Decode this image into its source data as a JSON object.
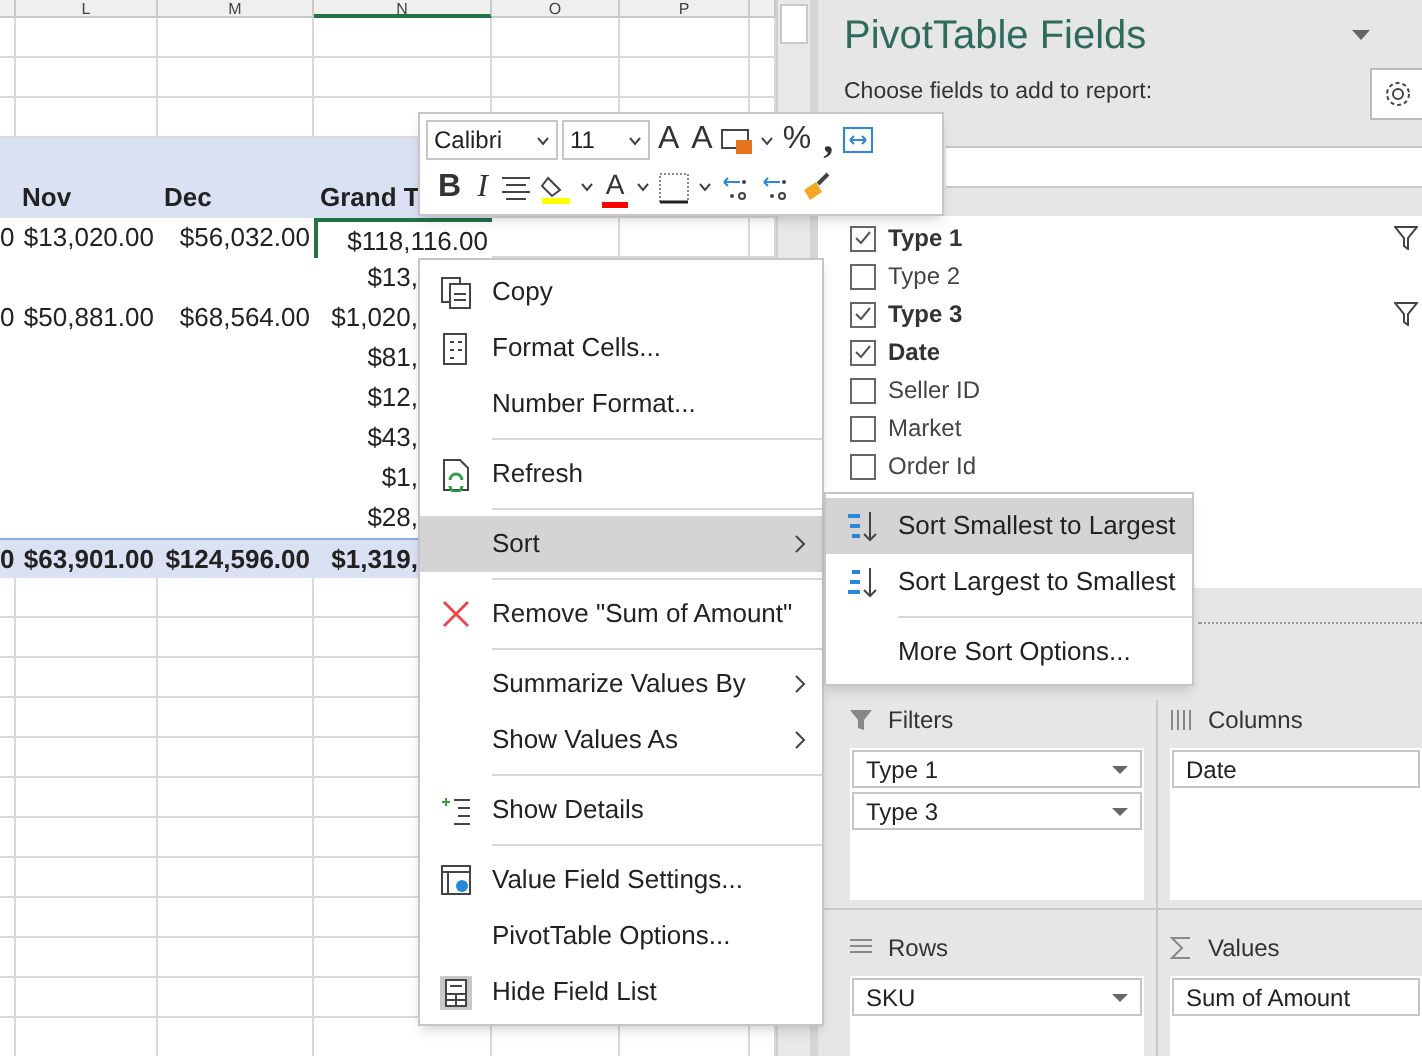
{
  "sheet": {
    "column_headers": [
      "L",
      "M",
      "N",
      "O",
      "P"
    ],
    "pivot": {
      "headers": [
        "Nov",
        "Dec",
        "Grand T"
      ],
      "rows": [
        {
          "first": "0",
          "nov": "$13,020.00",
          "dec": "$56,032.00",
          "grand": "$118,116.00",
          "selected": true
        },
        {
          "grand": "$13,",
          "selected": false
        },
        {
          "first": "0",
          "nov": "$50,881.00",
          "dec": "$68,564.00",
          "grand": "$1,020,",
          "selected": false
        },
        {
          "grand": "$81,",
          "selected": false
        },
        {
          "grand": "$12,",
          "selected": false
        },
        {
          "grand": "$43,",
          "selected": false
        },
        {
          "grand": "$1,",
          "selected": false
        },
        {
          "grand": "$28,",
          "selected": false
        }
      ],
      "total": {
        "first": "0",
        "nov": "$63,901.00",
        "dec": "$124,596.00",
        "grand": "$1,319,"
      }
    }
  },
  "mini_toolbar": {
    "font": "Calibri",
    "size": "11",
    "row1": [
      {
        "kind": "text",
        "label": "A"
      },
      {
        "kind": "text",
        "label": "A"
      },
      {
        "kind": "accounting"
      },
      {
        "kind": "text",
        "label": "%"
      },
      {
        "kind": "text",
        "label": ","
      },
      {
        "kind": "wrap"
      }
    ],
    "row2": [
      {
        "kind": "text",
        "label": "B"
      },
      {
        "kind": "text",
        "label": "I"
      },
      {
        "kind": "align"
      },
      {
        "kind": "fill"
      },
      {
        "kind": "fontcolor",
        "label": "A"
      },
      {
        "kind": "borders"
      },
      {
        "kind": "decimal"
      },
      {
        "kind": "decimal"
      },
      {
        "kind": "painter"
      }
    ]
  },
  "context_menu": {
    "groups": [
      [
        {
          "label": "Copy",
          "submenu": false,
          "selected": false
        },
        {
          "label": "Format Cells...",
          "submenu": false,
          "selected": false
        },
        {
          "label": "Number Format...",
          "submenu": false,
          "selected": false
        }
      ],
      [
        {
          "label": "Refresh",
          "submenu": false,
          "selected": false
        }
      ],
      [
        {
          "label": "Sort",
          "submenu": true,
          "selected": true
        }
      ],
      [
        {
          "label": "Remove \"Sum of Amount\"",
          "submenu": false,
          "selected": false
        }
      ],
      [
        {
          "label": "Summarize Values By",
          "submenu": true,
          "selected": false
        },
        {
          "label": "Show Values As",
          "submenu": true,
          "selected": false
        }
      ],
      [
        {
          "label": "Show Details",
          "submenu": false,
          "selected": false
        }
      ],
      [
        {
          "label": "Value Field Settings...",
          "submenu": false,
          "selected": false
        },
        {
          "label": "PivotTable Options...",
          "submenu": false,
          "selected": false
        },
        {
          "label": "Hide Field List",
          "submenu": false,
          "selected": false
        }
      ]
    ]
  },
  "sort_submenu": {
    "groups": [
      [
        {
          "label": "Sort Smallest to Largest",
          "selected": true
        },
        {
          "label": "Sort Largest to Smallest",
          "selected": false
        }
      ],
      [
        {
          "label": "More Sort Options...",
          "selected": false
        }
      ]
    ]
  },
  "pane": {
    "title": "PivotTable Fields",
    "subtitle": "Choose fields to add to report:",
    "fields": [
      {
        "label": "Type 1",
        "checked": true,
        "filtered": true
      },
      {
        "label": "Type 2",
        "checked": false,
        "filtered": false
      },
      {
        "label": "Type 3",
        "checked": true,
        "filtered": true
      },
      {
        "label": "Date",
        "checked": true,
        "filtered": false
      },
      {
        "label": "Seller ID",
        "checked": false,
        "filtered": false
      },
      {
        "label": "Market",
        "checked": false,
        "filtered": false
      },
      {
        "label": "Order Id",
        "checked": false,
        "filtered": false
      }
    ],
    "areas": [
      {
        "kind": "filters",
        "title": "Filters",
        "items": [
          "Type 1",
          "Type 3"
        ]
      },
      {
        "kind": "columns",
        "title": "Columns",
        "items": [
          "Date"
        ]
      },
      {
        "kind": "rows",
        "title": "Rows",
        "items": [
          "SKU"
        ]
      },
      {
        "kind": "values",
        "title": "Values",
        "items": [
          "Sum of Amount"
        ]
      }
    ]
  }
}
